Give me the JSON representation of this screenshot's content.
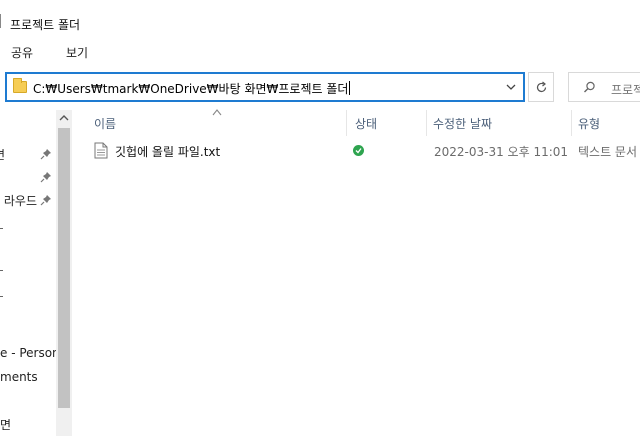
{
  "window": {
    "title": "프로젝트 폴더"
  },
  "ribbon": {
    "tabs": [
      "공유",
      "보기"
    ]
  },
  "address": {
    "path": "C:₩Users₩tmark₩OneDrive₩바탕 화면₩프로젝트 폴더"
  },
  "search": {
    "placeholder": "프로젝"
  },
  "nav": {
    "items": [
      {
        "label": "면",
        "pinned": true
      },
      {
        "label": "",
        "pinned": true
      },
      {
        "label": "라우드",
        "pinned": true
      },
      {
        "label": ""
      },
      {
        "label": ""
      },
      {
        "label": ""
      },
      {
        "label": "e - Persona"
      },
      {
        "label": "ments"
      },
      {
        "label": "면"
      }
    ]
  },
  "columns": {
    "name": "이름",
    "status": "상태",
    "modified": "수정한 날짜",
    "type": "유형"
  },
  "files": [
    {
      "name": "깃헙에 올릴 파일.txt",
      "status": "synced",
      "modified": "2022-03-31 오후 11:01",
      "type": "텍스트 문서"
    }
  ],
  "colors": {
    "accent": "#1e7bd1",
    "synced": "#2ea44f",
    "folder": "#f6cd55"
  },
  "icons": [
    "folder-icon",
    "dropdown-icon",
    "refresh-icon",
    "search-icon",
    "pin-icon",
    "scroll-up-icon",
    "sort-up-icon",
    "text-file-icon",
    "sync-check-icon"
  ]
}
